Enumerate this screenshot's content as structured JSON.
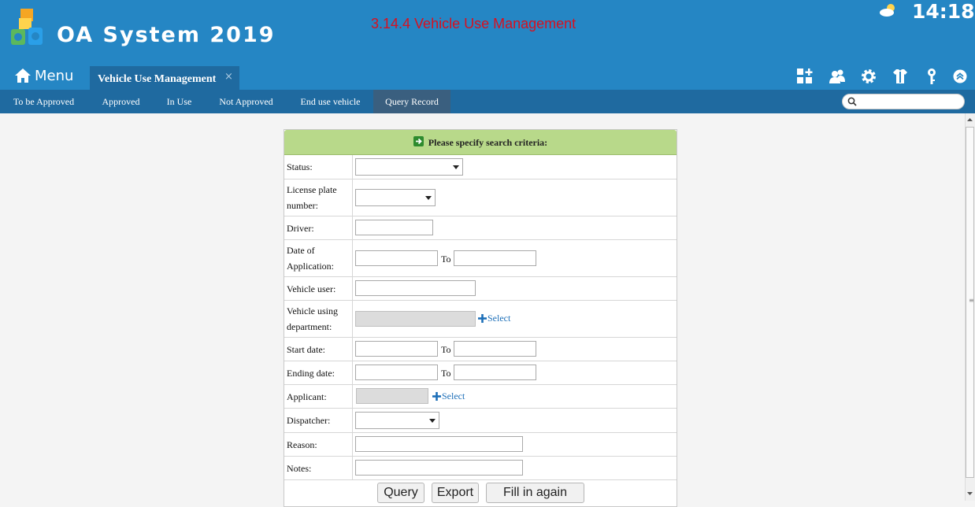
{
  "header": {
    "app_title": "OA System 2019",
    "module_title": "3.14.4 Vehicle Use Management",
    "clock": "14:18",
    "weather_icon": "partly-cloudy-icon",
    "brand_color": "#2586c4"
  },
  "nav": {
    "menu_label": "Menu",
    "active_tab": "Vehicle Use Management",
    "tab_close": "×",
    "tools": [
      "add-widget-icon",
      "users-icon",
      "gear-icon",
      "shirt-icon",
      "key-icon",
      "collapse-icon"
    ]
  },
  "subtabs": [
    "To be Approved",
    "Approved",
    "In Use",
    "Not Approved",
    "End use vehicle",
    "Query Record"
  ],
  "active_subtab": "Query Record",
  "search": {
    "placeholder": ""
  },
  "form": {
    "heading": "Please specify search criteria:",
    "labels": {
      "status": "Status:",
      "plate": "License plate number:",
      "driver": "Driver:",
      "date_app": "Date of Application:",
      "vehicle_user": "Vehicle user:",
      "department": "Vehicle using department:",
      "start_date": "Start date:",
      "ending_date": "Ending date:",
      "applicant": "Applicant:",
      "dispatcher": "Dispatcher:",
      "reason": "Reason:",
      "notes": "Notes:"
    },
    "to_label": "To",
    "select_label": "Select",
    "values": {
      "status": "",
      "plate": "",
      "driver": "",
      "date_app_from": "",
      "date_app_to": "",
      "vehicle_user": "",
      "department": "",
      "start_from": "",
      "start_to": "",
      "end_from": "",
      "end_to": "",
      "applicant": "",
      "dispatcher": "",
      "reason": "",
      "notes": ""
    }
  },
  "buttons": {
    "query": "Query",
    "export": "Export",
    "reset": "Fill in again"
  },
  "colors": {
    "panel_header": "#b8d98a",
    "subbar": "#1f6aa0",
    "module_title": "#d8101f",
    "link": "#1d6fb8"
  }
}
